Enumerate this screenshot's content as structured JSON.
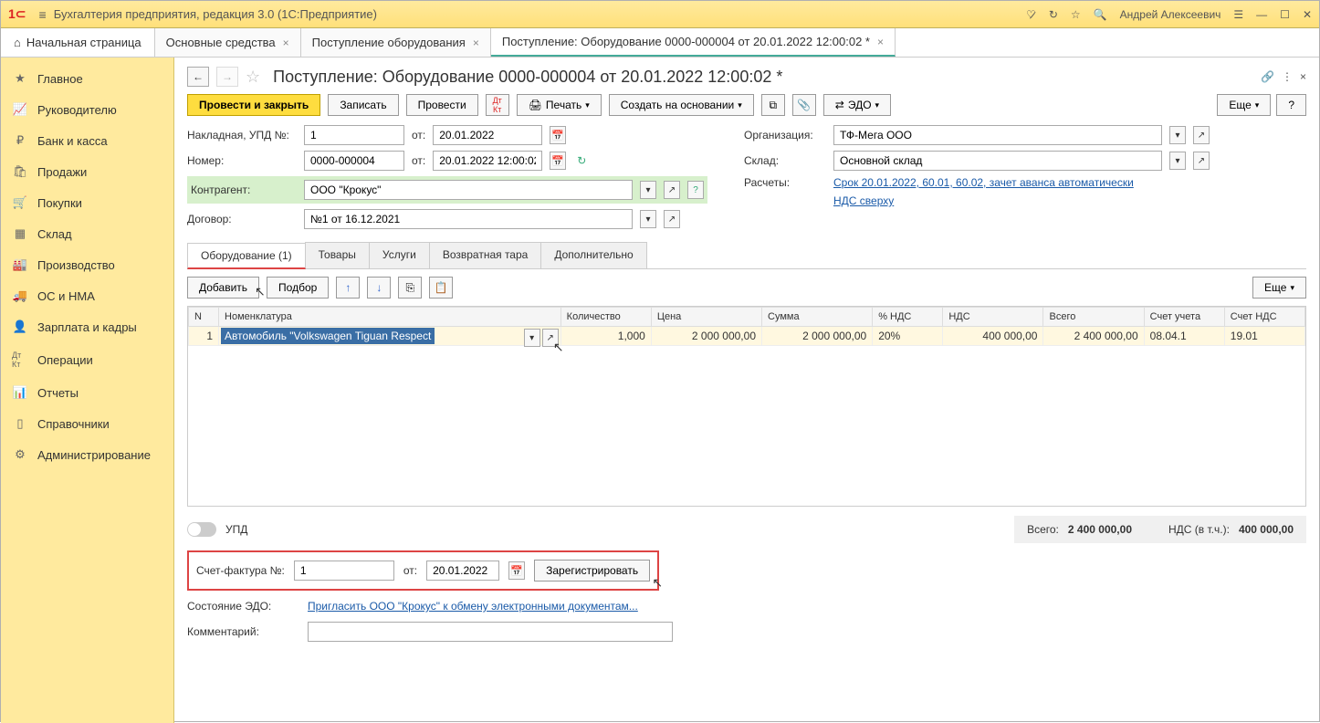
{
  "app": {
    "title": "Бухгалтерия предприятия, редакция 3.0  (1С:Предприятие)",
    "user": "Андрей Алексеевич"
  },
  "tabs": {
    "home": "Начальная страница",
    "items": [
      {
        "label": "Основные средства"
      },
      {
        "label": "Поступление оборудования"
      },
      {
        "label": "Поступление: Оборудование 0000-000004 от 20.01.2022 12:00:02 *"
      }
    ]
  },
  "sidebar": [
    {
      "label": "Главное"
    },
    {
      "label": "Руководителю"
    },
    {
      "label": "Банк и касса"
    },
    {
      "label": "Продажи"
    },
    {
      "label": "Покупки"
    },
    {
      "label": "Склад"
    },
    {
      "label": "Производство"
    },
    {
      "label": "ОС и НМА"
    },
    {
      "label": "Зарплата и кадры"
    },
    {
      "label": "Операции"
    },
    {
      "label": "Отчеты"
    },
    {
      "label": "Справочники"
    },
    {
      "label": "Администрирование"
    }
  ],
  "doc": {
    "title": "Поступление: Оборудование 0000-000004 от 20.01.2022 12:00:02 *"
  },
  "toolbar": {
    "post_close": "Провести и закрыть",
    "write": "Записать",
    "post": "Провести",
    "print": "Печать",
    "create_based": "Создать на основании",
    "edo": "ЭДО",
    "more": "Еще",
    "help": "?"
  },
  "fields": {
    "invoice_label": "Накладная, УПД №:",
    "invoice_no": "1",
    "ot": "от:",
    "invoice_date": "20.01.2022",
    "number_label": "Номер:",
    "number": "0000-000004",
    "number_date": "20.01.2022 12:00:02",
    "contragent_label": "Контрагент:",
    "contragent": "ООО \"Крокус\"",
    "q": "?",
    "dogovor_label": "Договор:",
    "dogovor": "№1 от 16.12.2021",
    "org_label": "Организация:",
    "org": "ТФ-Мега ООО",
    "sklad_label": "Склад:",
    "sklad": "Основной склад",
    "raschety_label": "Расчеты:",
    "raschety_link": "Срок 20.01.2022, 60.01, 60.02, зачет аванса автоматически",
    "nds_link": "НДС сверху"
  },
  "tabs2": {
    "equip": "Оборудование (1)",
    "goods": "Товары",
    "services": "Услуги",
    "tara": "Возвратная тара",
    "extra": "Дополнительно"
  },
  "subtoolbar": {
    "add": "Добавить",
    "pick": "Подбор",
    "more": "Еще"
  },
  "table": {
    "headers": {
      "n": "N",
      "nomen": "Номенклатура",
      "qty": "Количество",
      "price": "Цена",
      "sum": "Сумма",
      "vat_pct": "% НДС",
      "vat": "НДС",
      "total": "Всего",
      "acct": "Счет учета",
      "vat_acct": "Счет НДС"
    },
    "rows": [
      {
        "n": "1",
        "nomen": "Автомобиль \"Volkswagen Tiguan Respect",
        "qty": "1,000",
        "price": "2 000 000,00",
        "sum": "2 000 000,00",
        "vat_pct": "20%",
        "vat": "400 000,00",
        "total": "2 400 000,00",
        "acct": "08.04.1",
        "vat_acct": "19.01"
      }
    ]
  },
  "upd_label": "УПД",
  "totals": {
    "all_label": "Всего:",
    "all": "2 400 000,00",
    "vat_label": "НДС (в т.ч.):",
    "vat": "400 000,00"
  },
  "sf": {
    "label": "Счет-фактура №:",
    "no": "1",
    "ot": "от:",
    "date": "20.01.2022",
    "register": "Зарегистрировать"
  },
  "edo_state": {
    "label": "Состояние ЭДО:",
    "link": "Пригласить ООО \"Крокус\" к обмену электронными документам..."
  },
  "comment_label": "Комментарий:"
}
